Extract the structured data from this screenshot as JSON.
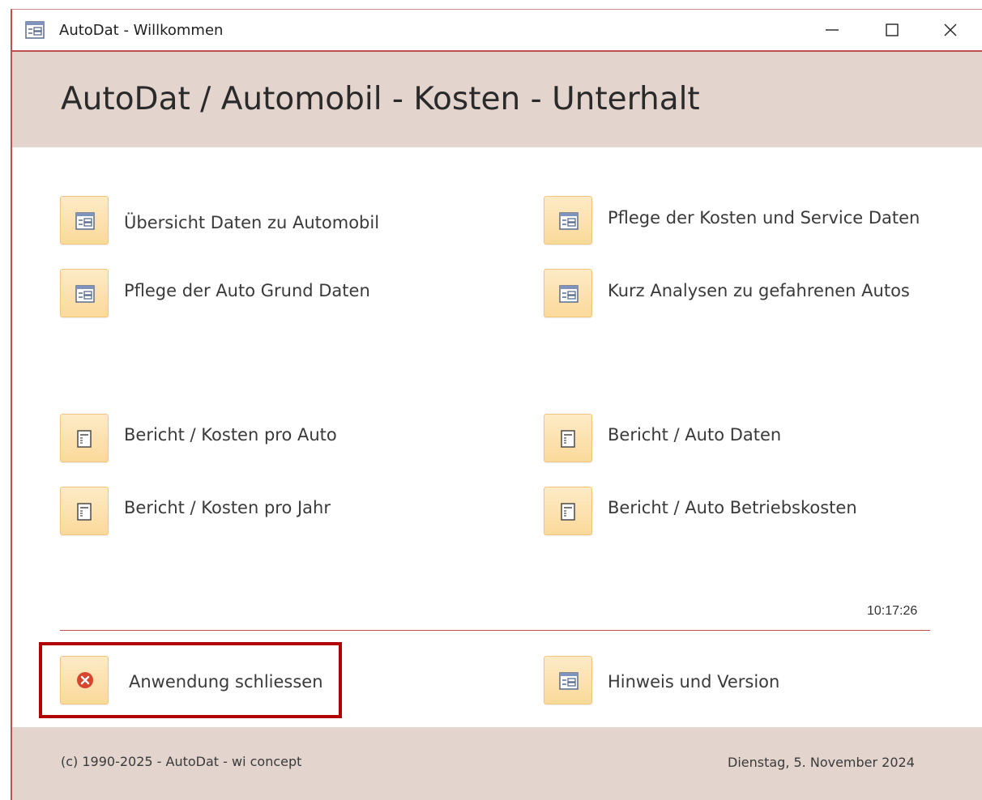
{
  "window": {
    "title": "AutoDat - Willkommen",
    "icon": "form-icon",
    "controls": {
      "minimize": "minimize-icon",
      "maximize": "maximize-icon",
      "close": "close-icon"
    }
  },
  "header": {
    "title": "AutoDat / Automobil - Kosten - Unterhalt"
  },
  "forms": [
    {
      "label": "Übersicht Daten zu Automobil",
      "icon": "form-icon"
    },
    {
      "label": "Pflege der Kosten und Service Daten",
      "icon": "form-icon"
    },
    {
      "label": "Pflege der Auto Grund Daten",
      "icon": "form-icon"
    },
    {
      "label": "Kurz Analysen zu gefahrenen Autos",
      "icon": "form-icon"
    }
  ],
  "reports": [
    {
      "label": "Bericht / Kosten pro Auto",
      "icon": "report-icon"
    },
    {
      "label": "Bericht / Auto Daten",
      "icon": "report-icon"
    },
    {
      "label": "Bericht / Kosten pro Jahr",
      "icon": "report-icon"
    },
    {
      "label": "Bericht / Auto Betriebskosten",
      "icon": "report-icon"
    }
  ],
  "status": {
    "time": "10:17:26"
  },
  "actions": {
    "close_app": {
      "label": "Anwendung schliessen",
      "icon": "error-close-icon"
    },
    "info": {
      "label": "Hinweis und Version",
      "icon": "form-icon"
    }
  },
  "footer": {
    "copyright": "(c) 1990-2025 - AutoDat - wi concept",
    "date": "Dienstag, 5. November 2024"
  },
  "colors": {
    "accent": "#c0504d",
    "band": "#e3d5cd",
    "tile": "#fbd99a",
    "highlight": "#b40000",
    "error": "#d9442f"
  }
}
